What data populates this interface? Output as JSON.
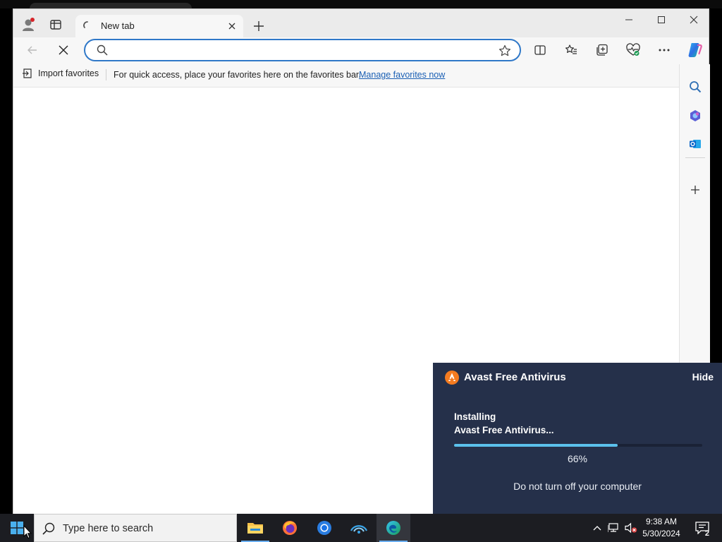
{
  "browser": {
    "tab": {
      "title": "New tab"
    },
    "address_bar": {
      "value": "",
      "placeholder": ""
    },
    "favorites_bar": {
      "import_label": "Import favorites",
      "message": "For quick access, place your favorites here on the favorites bar.",
      "manage_link": "Manage favorites now"
    },
    "icons": [
      "profile-icon",
      "workspaces-icon",
      "loading-icon",
      "close-icon",
      "new-tab-icon",
      "minimize-icon",
      "maximize-icon",
      "window-close-icon",
      "back-icon",
      "stop-loading-icon",
      "search-icon",
      "favorite-star-icon",
      "split-screen-icon",
      "favorites-icon",
      "collections-icon",
      "browser-essentials-icon",
      "more-options-icon",
      "copilot-icon"
    ],
    "sidebar_icons": [
      "sidebar-search-icon",
      "copilot-sidebar-icon",
      "outlook-icon",
      "sidebar-add-icon"
    ]
  },
  "toast": {
    "app": "Avast Free Antivirus",
    "hide_label": "Hide",
    "status_line1": "Installing",
    "status_line2": "Avast Free Antivirus...",
    "progress_percent": 66,
    "progress_label": "66%",
    "note": "Do not turn off your computer",
    "colors": {
      "background": "#25304a",
      "progress": "#5bc1ec",
      "logo": "#f47b20"
    }
  },
  "taskbar": {
    "search_placeholder": "Type here to search",
    "apps": [
      "file-explorer-icon",
      "firefox-icon",
      "chrome-icon",
      "network-app-icon",
      "edge-icon"
    ],
    "clock": {
      "time": "9:38 AM",
      "date": "5/30/2024"
    },
    "notification_count": "2"
  }
}
